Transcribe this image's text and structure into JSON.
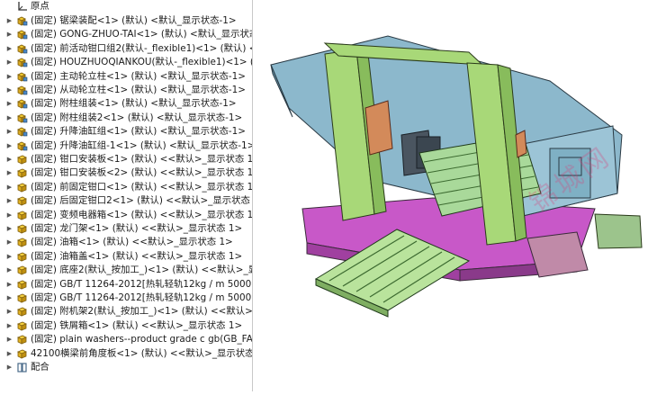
{
  "tree": {
    "origin_label": "原点",
    "mates_label": "配合",
    "items": [
      {
        "label": "(固定) 锯梁装配<1> (默认) <默认_显示状态-1>",
        "type": "assembly"
      },
      {
        "label": "(固定) GONG-ZHUO-TAI<1> (默认) <默认_显示状态-1>",
        "type": "assembly"
      },
      {
        "label": "(固定) 前活动钳口组2(默认-_flexible1)<1> (默认) <默认",
        "type": "assembly"
      },
      {
        "label": "(固定) HOUZHUOQIANKOU(默认-_flexible1)<1> (默认",
        "type": "assembly"
      },
      {
        "label": "(固定) 主动轮立柱<1> (默认) <默认_显示状态-1>",
        "type": "assembly"
      },
      {
        "label": "(固定) 从动轮立柱<1> (默认) <默认_显示状态-1>",
        "type": "assembly"
      },
      {
        "label": "(固定) 附柱组装<1> (默认) <默认_显示状态-1>",
        "type": "assembly"
      },
      {
        "label": "(固定) 附柱组装2<1> (默认) <默认_显示状态-1>",
        "type": "assembly"
      },
      {
        "label": "(固定) 升降油缸组<1> (默认) <默认_显示状态-1>",
        "type": "assembly"
      },
      {
        "label": "(固定) 升降油缸组-1<1> (默认) <默认_显示状态-1>",
        "type": "assembly"
      },
      {
        "label": "(固定) 钳口安装板<1> (默认) <<默认>_显示状态 1>",
        "type": "part"
      },
      {
        "label": "(固定) 钳口安装板<2> (默认) <<默认>_显示状态 1>",
        "type": "part"
      },
      {
        "label": "(固定) 前固定钳口<1> (默认) <<默认>_显示状态 1>",
        "type": "part"
      },
      {
        "label": "(固定) 后固定钳口2<1> (默认) <<默认>_显示状态 1>",
        "type": "part"
      },
      {
        "label": "(固定) 变频电器箱<1> (默认) <<默认>_显示状态 1>",
        "type": "part"
      },
      {
        "label": "(固定) 龙门架<1> (默认) <<默认>_显示状态 1>",
        "type": "part"
      },
      {
        "label": "(固定) 油箱<1> (默认) <<默认>_显示状态 1>",
        "type": "part"
      },
      {
        "label": "(固定) 油箱盖<1> (默认) <<默认>_显示状态 1>",
        "type": "part"
      },
      {
        "label": "(固定) 底座2(默认_按加工_)<1> (默认) <<默认>_显示状",
        "type": "part"
      },
      {
        "label": "(固定) GB/T 11264-2012[热轧轻轨12kg / m 5000]<1>",
        "type": "part"
      },
      {
        "label": "(固定) GB/T 11264-2012[热轧轻轨12kg / m 5000]<2>",
        "type": "part"
      },
      {
        "label": "(固定) 附机架2(默认_按加工_)<1> (默认) <<默认>_显示",
        "type": "part"
      },
      {
        "label": "(固定) 铁屑箱<1> (默认) <<默认>_显示状态 1>",
        "type": "part"
      },
      {
        "label": "(固定) plain washers--product grade c gb(GB_FASTE",
        "type": "part"
      },
      {
        "label": "42100横梁前角度板<1> (默认) <<默认>_显示状态 1>",
        "type": "part"
      }
    ]
  },
  "viewport": {
    "watermark": "锦城网"
  }
}
